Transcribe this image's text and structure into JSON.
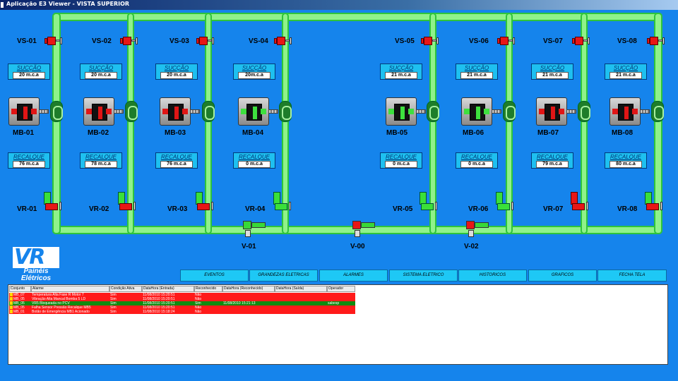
{
  "window": {
    "title": "Aplicação E3 Viewer - VISTA SUPERIOR"
  },
  "suction_valves": [
    {
      "label": "VS-01"
    },
    {
      "label": "VS-02"
    },
    {
      "label": "VS-03"
    },
    {
      "label": "VS-04"
    },
    {
      "label": "VS-05"
    },
    {
      "label": "VS-06"
    },
    {
      "label": "VS-07"
    },
    {
      "label": "VS-08"
    }
  ],
  "succao": [
    {
      "caption": "SUCÇÃO",
      "value": "20 m.c.a"
    },
    {
      "caption": "SUCÇÃO",
      "value": "20 m.c.a"
    },
    {
      "caption": "SUCÇÃO",
      "value": "20 m.c.a"
    },
    {
      "caption": "SUCÇÃO",
      "value": "20m.c.a"
    },
    {
      "caption": "SUCÇÃO",
      "value": "21 m.c.a"
    },
    {
      "caption": "SUCÇÃO",
      "value": "21 m.c.a"
    },
    {
      "caption": "SUCÇÃO",
      "value": "21 m.c.a"
    },
    {
      "caption": "SUCÇÃO",
      "value": "21 m.c.a"
    }
  ],
  "pumps": [
    {
      "label": "MB-01",
      "state": "off"
    },
    {
      "label": "MB-02",
      "state": "off"
    },
    {
      "label": "MB-03",
      "state": "off"
    },
    {
      "label": "MB-04",
      "state": "on"
    },
    {
      "label": "MB-05",
      "state": "on"
    },
    {
      "label": "MB-06",
      "state": "on"
    },
    {
      "label": "MB-07",
      "state": "off"
    },
    {
      "label": "MB-08",
      "state": "off"
    }
  ],
  "recalque": [
    {
      "caption": "RECALQUE",
      "value": "76 m.c.a"
    },
    {
      "caption": "RECALQUE",
      "value": "78 m.c.a"
    },
    {
      "caption": "RECALQUE",
      "value": "76 m.c.a"
    },
    {
      "caption": "RECALQUE",
      "value": "0 m.c.a"
    },
    {
      "caption": "RECALQUE",
      "value": "0 m.c.a"
    },
    {
      "caption": "RECALQUE",
      "value": "0 m.c.a"
    },
    {
      "caption": "RECALQUE",
      "value": "79 m.c.a"
    },
    {
      "caption": "RECALQUE",
      "value": "80 m.c.a"
    }
  ],
  "return_valves": [
    {
      "label": "VR-01"
    },
    {
      "label": "VR-02"
    },
    {
      "label": "VR-03"
    },
    {
      "label": "VR-04"
    },
    {
      "label": "VR-05"
    },
    {
      "label": "VR-06"
    },
    {
      "label": "VR-07"
    },
    {
      "label": "VR-08"
    }
  ],
  "line_valves": [
    {
      "label": "V-01"
    },
    {
      "label": "V-00"
    },
    {
      "label": "V-02"
    }
  ],
  "logo": {
    "mark": "VR",
    "line1": "Painéis",
    "line2": "Elétricos"
  },
  "nav": [
    "EVENTOS",
    "GRANDEZAS ELETRICAS",
    "ALARMES",
    "SISTEMA ELETRICO",
    "HISTORICOS",
    "GRAFICOS",
    "FECHA TELA"
  ],
  "alarm_table": {
    "headers": [
      "Conjunto",
      "Alarme",
      "Condição Ativa",
      "DataHora (Entrada)",
      "Reconhecido",
      "DataHora (Reconhecido)",
      "DataHora (Saída)",
      "Operador"
    ],
    "rows": [
      {
        "color": "#ff1a1a",
        "cells": [
          "MB_07",
          "Temperatura Alta Fase  R Motor 7",
          "Sim",
          "11/08/2010 15:20:51",
          "Não",
          "",
          "",
          ""
        ]
      },
      {
        "color": "#ff1a1a",
        "cells": [
          "MB_05",
          "Vibração Alta Mancal Bomba 5 LD",
          "Sim",
          "11/08/2010 15:20:51",
          "Não",
          "",
          "",
          ""
        ]
      },
      {
        "color": "#108a10",
        "cells": [
          "MB_05",
          "VR5 Bloqueada no PCV",
          "Sim",
          "11/08/2010 15:20:51",
          "Sim",
          "11/08/2010 15:21:13",
          "",
          "sabesp"
        ]
      },
      {
        "color": "#ff1a1a",
        "cells": [
          "MB_05",
          "Falha Sensor Pressão Recalque MB5",
          "Sim",
          "11/08/2010 15:20:51",
          "Não",
          "",
          "",
          ""
        ]
      },
      {
        "color": "#ff1a1a",
        "cells": [
          "MB_01",
          "Botão de Emergência MB1 Acionado",
          "Sim",
          "11/08/2010 15:18:24",
          "Não",
          "",
          "",
          ""
        ]
      }
    ]
  }
}
